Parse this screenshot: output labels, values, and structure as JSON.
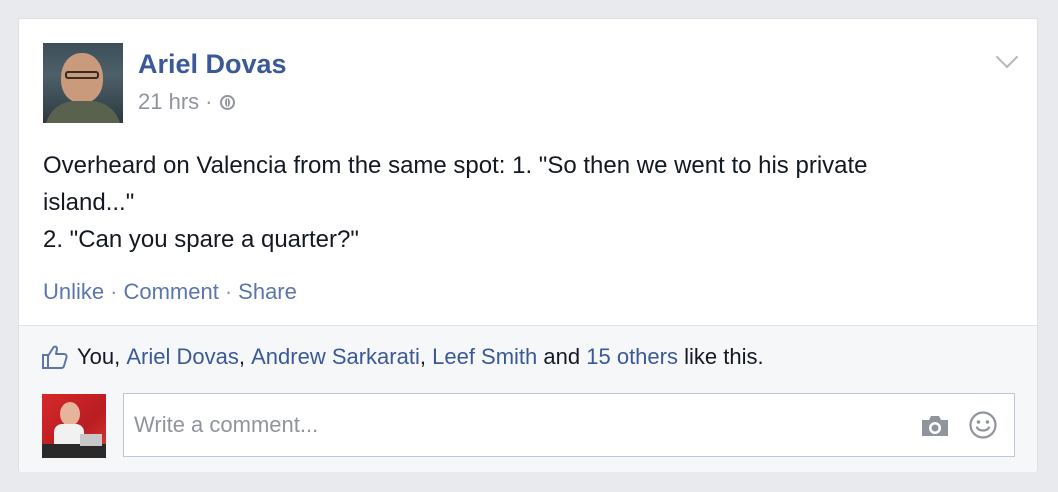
{
  "post": {
    "author": "Ariel Dovas",
    "timestamp": "21 hrs",
    "meta_separator": "·",
    "privacy_icon": "globe-icon",
    "text_lines": [
      "Overheard on Valencia from the same spot: 1. \"So then we went to his private",
      "island...\"",
      "2. \"Can you spare a quarter?\""
    ],
    "options_icon": "chevron-down-icon"
  },
  "actions": {
    "unlike": "Unlike",
    "comment": "Comment",
    "share": "Share",
    "separator": "·"
  },
  "likes": {
    "icon": "thumbs-up-icon",
    "you": "You",
    "comma": ",",
    "names": [
      "Ariel Dovas",
      "Andrew Sarkarati",
      "Leef Smith"
    ],
    "and": "and",
    "others": "15 others",
    "suffix": "like this."
  },
  "comment_input": {
    "placeholder": "Write a comment...",
    "camera_icon": "camera-icon",
    "emoji_icon": "smiley-icon"
  },
  "colors": {
    "link": "#3b5998",
    "action_link": "#5c76ad",
    "muted": "#90949c",
    "text": "#141823",
    "background": "#e9eaed"
  }
}
